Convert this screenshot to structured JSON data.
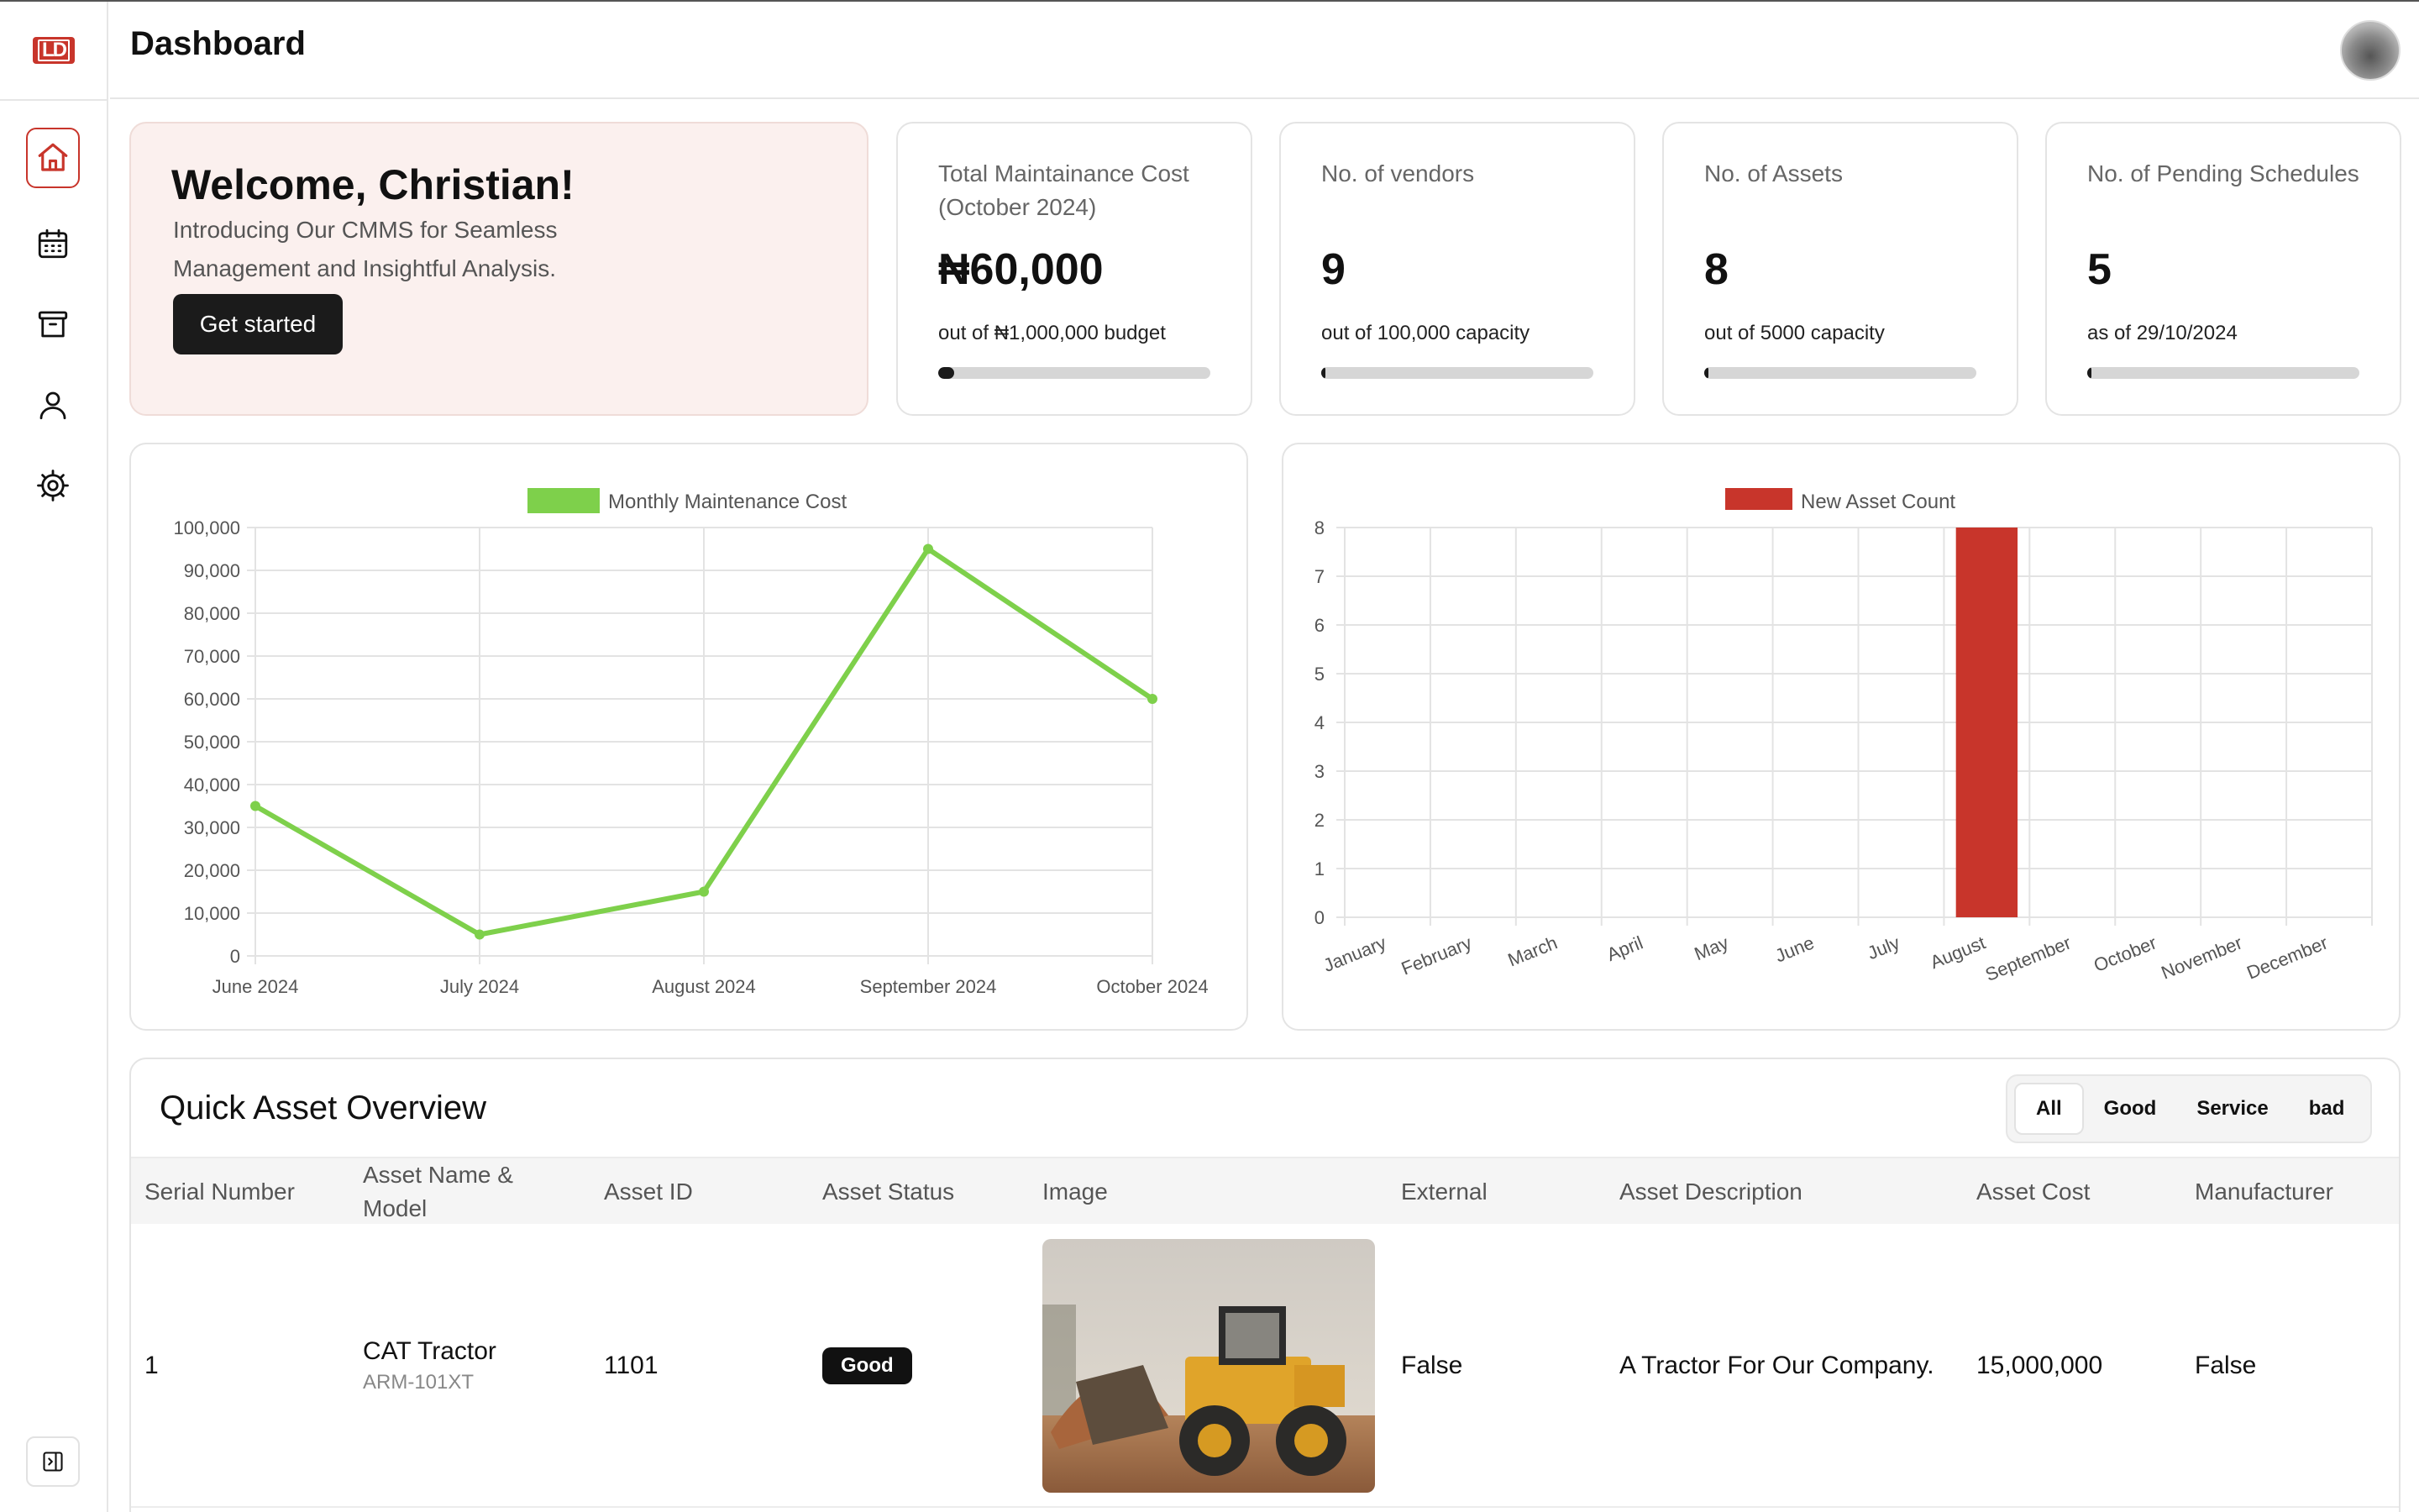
{
  "app": {
    "logo_text": "LD"
  },
  "header": {
    "title": "Dashboard"
  },
  "sidebar": {
    "items": [
      {
        "icon": "home-icon",
        "active": true
      },
      {
        "icon": "calendar-icon",
        "active": false
      },
      {
        "icon": "archive-icon",
        "active": false
      },
      {
        "icon": "user-icon",
        "active": false
      },
      {
        "icon": "gear-icon",
        "active": false
      }
    ]
  },
  "welcome": {
    "heading": "Welcome, Christian!",
    "text": "Introducing Our CMMS for Seamless Management and Insightful Analysis.",
    "button": "Get started"
  },
  "stats": [
    {
      "label": "Total Maintainance Cost (October 2024)",
      "value": "₦60,000",
      "sub": "out of ₦1,000,000 budget",
      "progress": 0.06
    },
    {
      "label": "No. of vendors",
      "value": "9",
      "sub": "out of 100,000 capacity",
      "progress": 0.0001
    },
    {
      "label": "No. of Assets",
      "value": "8",
      "sub": "out of 5000 capacity",
      "progress": 0.0016
    },
    {
      "label": "No. of Pending Schedules",
      "value": "5",
      "sub": "as of 29/10/2024",
      "progress": 0.01
    }
  ],
  "chart_data": [
    {
      "type": "line",
      "legend": [
        "Monthly Maintenance Cost"
      ],
      "x": [
        "June 2024",
        "July 2024",
        "August 2024",
        "September 2024",
        "October 2024"
      ],
      "series": [
        {
          "name": "Monthly Maintenance Cost",
          "values": [
            35000,
            5000,
            15000,
            95000,
            60000
          ],
          "color": "#7ed04b"
        }
      ],
      "ylim": [
        0,
        100000
      ],
      "yticks": [
        "0",
        "10,000",
        "20,000",
        "30,000",
        "40,000",
        "50,000",
        "60,000",
        "70,000",
        "80,000",
        "90,000",
        "100,000"
      ],
      "grid": true,
      "legend_position": "top"
    },
    {
      "type": "bar",
      "legend": [
        "New Asset Count"
      ],
      "categories": [
        "January",
        "February",
        "March",
        "April",
        "May",
        "June",
        "July",
        "August",
        "September",
        "October",
        "November",
        "December"
      ],
      "series": [
        {
          "name": "New Asset Count",
          "values": [
            0,
            0,
            0,
            0,
            0,
            0,
            0,
            8,
            0,
            0,
            0,
            0
          ],
          "color": "#c8352b"
        }
      ],
      "ylim": [
        0,
        8
      ],
      "yticks": [
        "0",
        "1",
        "2",
        "3",
        "4",
        "5",
        "6",
        "7",
        "8"
      ],
      "grid": true,
      "legend_position": "top"
    }
  ],
  "table": {
    "title": "Quick Asset Overview",
    "filters": [
      "All",
      "Good",
      "Service",
      "bad"
    ],
    "active_filter": "All",
    "columns": [
      "Serial Number",
      "Asset Name & Model",
      "Asset ID",
      "Asset Status",
      "Image",
      "External",
      "Asset Description",
      "Asset Cost",
      "Manufacturer"
    ],
    "rows": [
      {
        "serial": "1",
        "name": "CAT Tractor",
        "model": "ARM-101XT",
        "asset_id": "1101",
        "status": "Good",
        "external": "False",
        "description": "A Tractor For Our Company.",
        "cost": "15,000,000",
        "manufacturer": "False"
      }
    ]
  },
  "colors": {
    "accent": "#c8352b",
    "line": "#7ed04b",
    "dark": "#1b1b1b",
    "welcome_bg": "#fbf0ee"
  }
}
